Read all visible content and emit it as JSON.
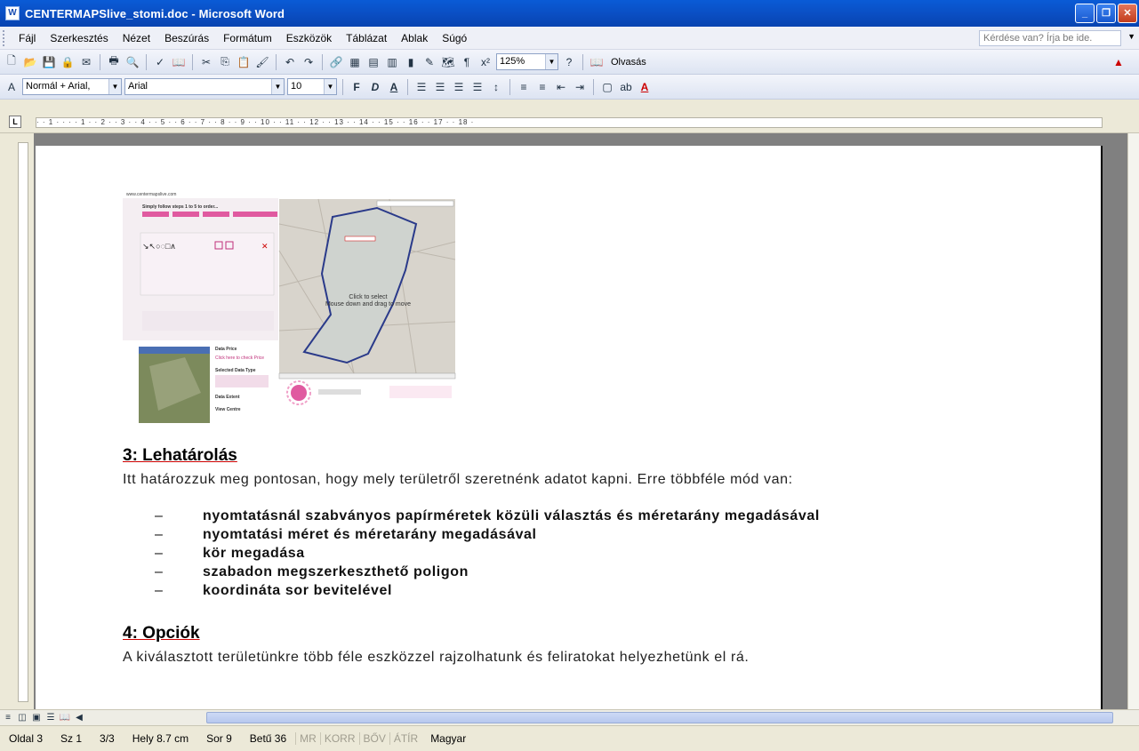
{
  "window": {
    "title": "CENTERMAPSlive_stomi.doc - Microsoft Word",
    "app_icon": "word-icon"
  },
  "menu": [
    "Fájl",
    "Szerkesztés",
    "Nézet",
    "Beszúrás",
    "Formátum",
    "Eszközök",
    "Táblázat",
    "Ablak",
    "Súgó"
  ],
  "help_box": {
    "placeholder": "Kérdése van? Írja be ide."
  },
  "toolbar": {
    "zoom": "125%",
    "reading_label": "Olvasás"
  },
  "format_toolbar": {
    "style": "Normál + Arial,",
    "font": "Arial",
    "size": "10"
  },
  "ruler": {
    "ticks": "· · 1 · · · · 1 · · 2 · · 3 · · 4 · · 5 · · 6 · · 7 · · 8 · · 9 · · 10 · · 11 · · 12 · · 13 · · 14 · · 15 · · 16 · · 17 · · 18 ·"
  },
  "document": {
    "embedded_map": {
      "url_text": "www.centermapslive.com",
      "step_text": "Simply follow steps 1 to 5 to order...",
      "overlay_line1": "Click to select",
      "overlay_line2": "Mouse down and drag to move",
      "data_price_label": "Data Price",
      "check_price_link": "Click here to check Price",
      "selected_type_label": "Selected Data Type",
      "data_extent_label": "Data Extent",
      "view_centre_label": "View Centre"
    },
    "section3_title": "3: Lehatárolás",
    "section3_text": "Itt határozzuk meg pontosan, hogy mely területről szeretnénk adatot kapni. Erre többféle mód van:",
    "bullets": [
      "nyomtatásnál szabványos papírméretek közüli választás és méretarány megadásával",
      "nyomtatási méret és méretarány megadásával",
      "kör megadása",
      "szabadon megszerkeszthető poligon",
      "koordináta sor bevitelével"
    ],
    "section4_title": "4: Opciók",
    "section4_text": "A kiválasztott területünkre több féle eszközzel rajzolhatunk és feliratokat helyezhetünk el rá."
  },
  "status": {
    "page": "Oldal 3",
    "section": "Sz 1",
    "pages": "3/3",
    "position": "Hely 8.7 cm",
    "line": "Sor 9",
    "column": "Betű 36",
    "flags": [
      "MR",
      "KORR",
      "BŐV",
      "ÁTÍR"
    ],
    "language": "Magyar"
  }
}
